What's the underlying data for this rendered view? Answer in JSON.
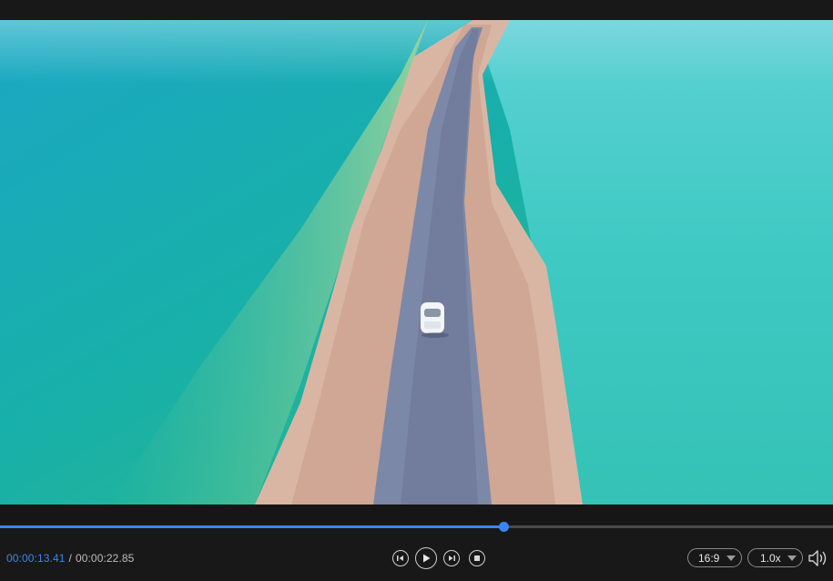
{
  "player": {
    "current_time": "00:00:13.41",
    "separator": "/",
    "total_time": "00:00:22.85",
    "progress_fraction": 0.6042,
    "accent_color": "#3a86f0",
    "aspect_ratio": "16:9",
    "playback_speed": "1.0x"
  },
  "icons": {
    "prev_frame": "step-back-icon",
    "play": "play-icon",
    "next_frame": "step-forward-icon",
    "stop": "stop-icon",
    "volume": "volume-icon",
    "dropdown": "caret-down-icon"
  },
  "scene": "aerial view of a white car on a narrow road between turquoise salt lake waters"
}
